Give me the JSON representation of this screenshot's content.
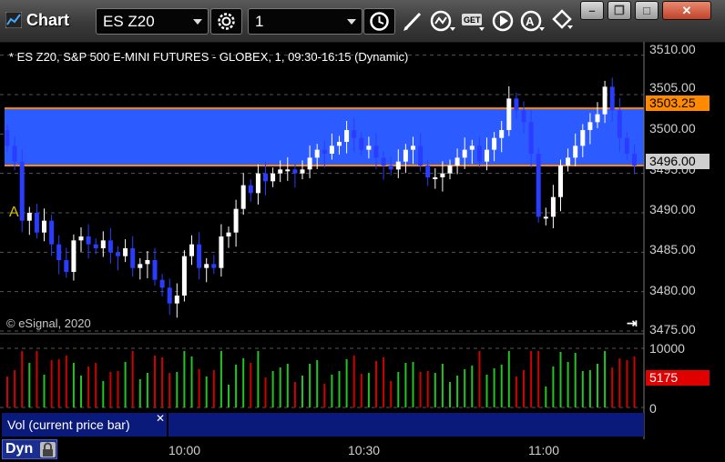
{
  "window": {
    "title": "Chart",
    "symbol": "ES Z20",
    "interval": "1"
  },
  "chart": {
    "title_line": "* ES Z20, S&P 500 E-MINI FUTURES - GLOBEX, 1, 09:30-16:15 (Dynamic)",
    "copyright": "© eSignal, 2020",
    "marker": "A",
    "highlight_zone": {
      "top_price": 3503.25,
      "bottom_price": 3496.0,
      "color": "#2c5cff"
    },
    "current_price_label": "3503.25",
    "last_price_label": "3496.00",
    "price_ticks": [
      "3510.00",
      "3505.00",
      "3500.00",
      "3495.00",
      "3490.00",
      "3485.00",
      "3480.00",
      "3475.00"
    ],
    "time_ticks": [
      "10:00",
      "10:30",
      "11:00"
    ],
    "volume_ticks": [
      "10000",
      "0"
    ],
    "volume_current_label": "5175",
    "volume_study_label": "Vol (current price bar)",
    "dyn_label": "Dyn"
  },
  "chart_data": {
    "type": "candlestick",
    "title": "* ES Z20, S&P 500 E-MINI FUTURES - GLOBEX, 1, 09:30-16:15 (Dynamic)",
    "ylim": [
      3475,
      3511
    ],
    "x_ticks": [
      "10:00",
      "10:30",
      "11:00"
    ],
    "closes": [
      3498.5,
      3496.5,
      3489.0,
      3490.0,
      3487.5,
      3489.0,
      3486.0,
      3484.0,
      3482.5,
      3486.5,
      3487.0,
      3486.0,
      3485.5,
      3486.5,
      3485.0,
      3484.5,
      3485.5,
      3483.0,
      3483.5,
      3484.0,
      3481.5,
      3480.5,
      3478.5,
      3479.5,
      3484.5,
      3486.0,
      3483.0,
      3483.5,
      3483.0,
      3487.0,
      3487.5,
      3490.5,
      3493.5,
      3492.5,
      3495.0,
      3494.0,
      3495.0,
      3495.5,
      3495.5,
      3495.0,
      3495.5,
      3497.0,
      3498.0,
      3497.5,
      3498.5,
      3499.0,
      3500.5,
      3499.5,
      3498.0,
      3498.5,
      3497.0,
      3496.0,
      3495.5,
      3496.5,
      3498.0,
      3498.5,
      3496.0,
      3494.5,
      3494.5,
      3495.0,
      3496.0,
      3497.0,
      3498.0,
      3498.5,
      3496.5,
      3498.0,
      3499.5,
      3500.5,
      3504.5,
      3503.0,
      3501.5,
      3497.5,
      3489.5,
      3489.5,
      3492.0,
      3496.0,
      3497.0,
      3498.5,
      3500.5,
      3501.5,
      3502.5,
      3506.0,
      3503.0,
      3499.5,
      3497.5,
      3496.0
    ],
    "volume_ticks": [
      "10000",
      "0"
    ],
    "volume_last": 5175
  }
}
